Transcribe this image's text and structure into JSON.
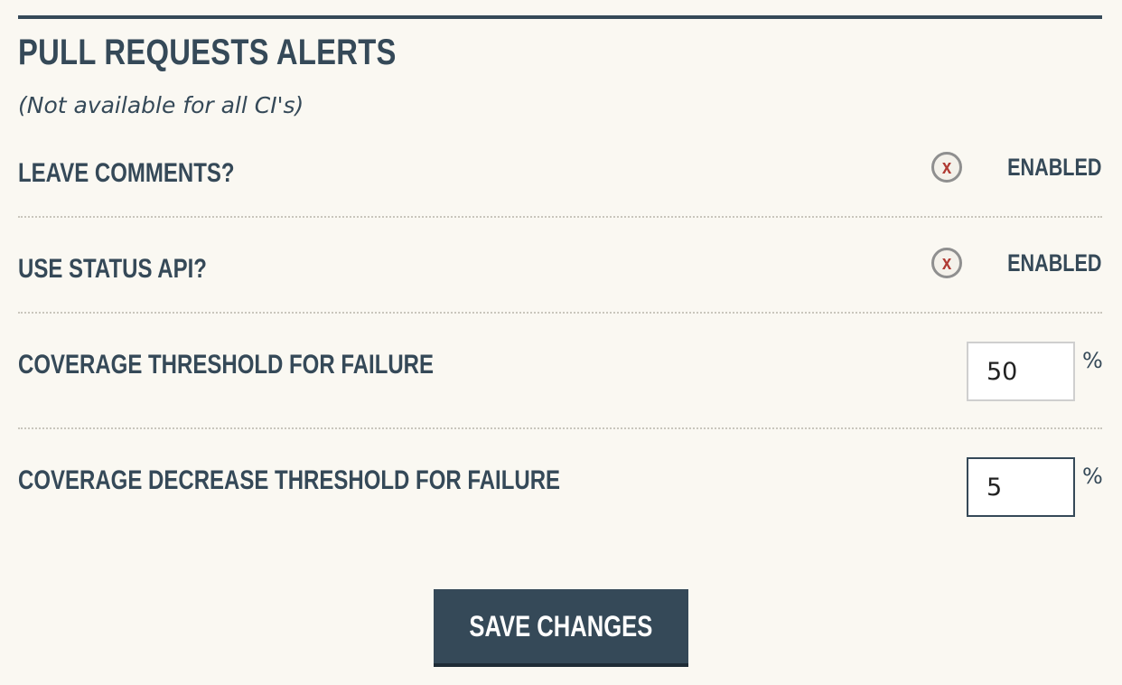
{
  "section": {
    "title": "PULL REQUESTS ALERTS",
    "subtitle": "(Not available for all CI's)"
  },
  "settings": [
    {
      "label": "LEAVE COMMENTS?",
      "toggle_icon": "x-icon",
      "toggle_glyph": "x",
      "toggle_text": "ENABLED"
    },
    {
      "label": "USE STATUS API?",
      "toggle_icon": "x-icon",
      "toggle_glyph": "x",
      "toggle_text": "ENABLED"
    },
    {
      "label": "COVERAGE THRESHOLD FOR FAILURE",
      "value": "50",
      "unit": "%"
    },
    {
      "label": "COVERAGE DECREASE THRESHOLD FOR FAILURE",
      "value": "5",
      "unit": "%"
    }
  ],
  "actions": {
    "save_label": "SAVE CHANGES"
  },
  "colors": {
    "background": "#faf8f2",
    "primary": "#354958",
    "toggle_x": "#b03a33",
    "toggle_ring": "#8f8f8f"
  }
}
